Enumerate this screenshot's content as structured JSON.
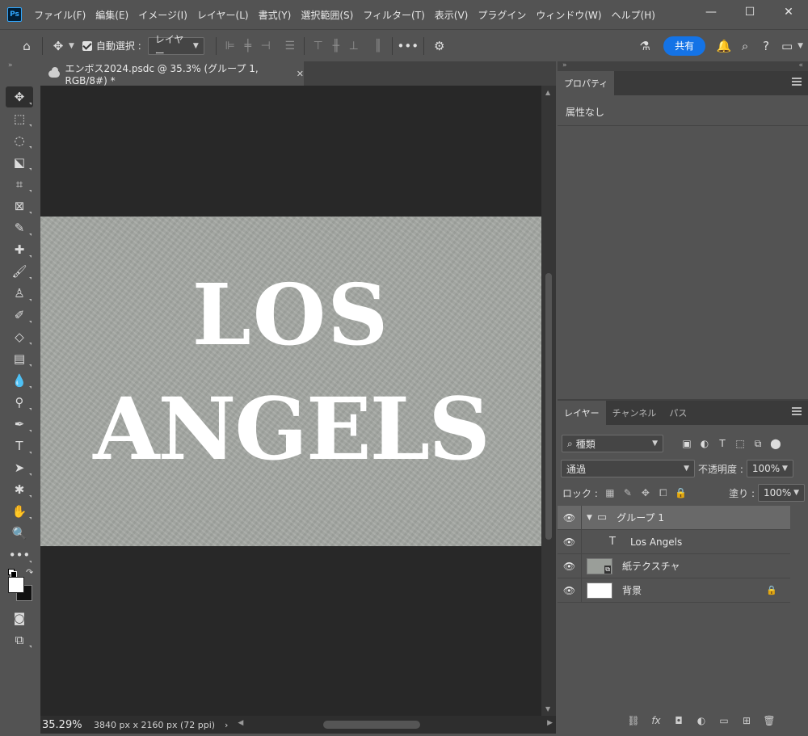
{
  "app": {
    "logo_text": "Ps"
  },
  "menu": [
    "ファイル(F)",
    "編集(E)",
    "イメージ(I)",
    "レイヤー(L)",
    "書式(Y)",
    "選択範囲(S)",
    "フィルター(T)",
    "表示(V)",
    "プラグイン",
    "ウィンドウ(W)",
    "ヘルプ(H)"
  ],
  "window_controls": {
    "minimize": "—",
    "maximize": "☐",
    "close": "✕"
  },
  "options": {
    "auto_select_label": "自動選択 :",
    "auto_select_checked": true,
    "auto_select_target": "レイヤー",
    "share_label": "共有"
  },
  "document": {
    "tab_title": "エンボス2024.psdc @ 35.3% (グループ 1, RGB/8#) *",
    "line1": "LOS",
    "line2": "ANGELS"
  },
  "status": {
    "zoom": "35.29%",
    "dimensions": "3840 px x 2160 px (72 ppi)"
  },
  "properties": {
    "tab_label": "プロパティ",
    "empty_text": "属性なし"
  },
  "layers_panel": {
    "tabs": [
      "レイヤー",
      "チャンネル",
      "パス"
    ],
    "filter_kind": "種類",
    "blend_mode": "通過",
    "opacity_label": "不透明度 :",
    "opacity_value": "100%",
    "lock_label": "ロック :",
    "fill_label": "塗り :",
    "fill_value": "100%",
    "layers": [
      {
        "name": "グループ 1",
        "type": "group"
      },
      {
        "name": "Los Angels",
        "type": "text"
      },
      {
        "name": "紙テクスチャ",
        "type": "smart-object"
      },
      {
        "name": "背景",
        "type": "background"
      }
    ]
  },
  "colors": {
    "accent": "#1473e6",
    "canvas_paper": "#a4a8a3",
    "foreground": "#ffffff",
    "background": "#111111"
  }
}
